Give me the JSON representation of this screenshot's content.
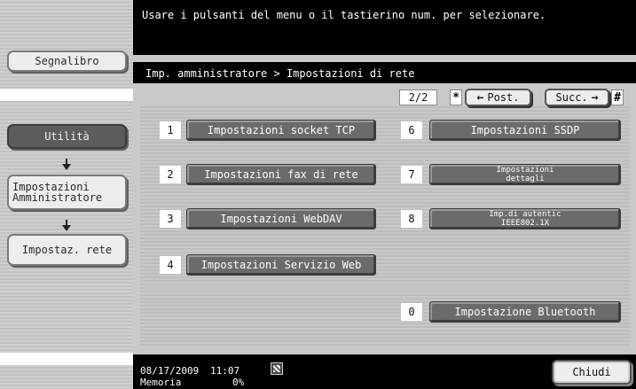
{
  "message": "Usare i pulsanti del menu o il tastierino num. per selezionare.",
  "sidebar": {
    "bookmark": "Segnalibro",
    "path": [
      "Utilità",
      "Impostazioni Amministratore",
      "Impostaz. rete"
    ]
  },
  "breadcrumb": "Imp. amministratore > Impostazioni di rete",
  "pagination": {
    "indicator": "2/2",
    "star": "*",
    "prev": "Post.",
    "next": "Succ.",
    "hash": "#"
  },
  "menu": [
    {
      "num": "1",
      "label": "Impostazioni socket TCP"
    },
    {
      "num": "2",
      "label": "Impostazioni fax di rete"
    },
    {
      "num": "3",
      "label": "Impostazioni WebDAV"
    },
    {
      "num": "4",
      "label": "Impostazioni Servizio Web"
    },
    {
      "num": "6",
      "label": "Impostazioni SSDP"
    },
    {
      "num": "7",
      "label": "Impostazioni\ndettagli"
    },
    {
      "num": "8",
      "label": "Imp.di autentic\nIEEE802.1X"
    },
    {
      "num": "0",
      "label": "Impostazione Bluetooth"
    }
  ],
  "status": {
    "date": "08/17/2009",
    "time": "11:07",
    "memory_label": "Memoria",
    "memory_value": "0%"
  },
  "close": "Chiudi"
}
